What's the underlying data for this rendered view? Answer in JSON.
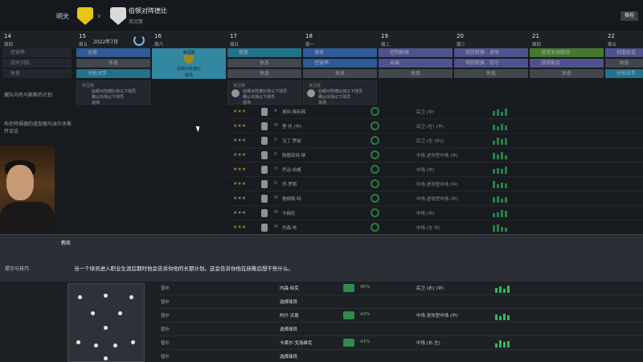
{
  "header": {
    "when": "明天",
    "vs": "v",
    "opponent": "伯顿对阵德比",
    "competition": "英冠赛",
    "right_button": "赛程"
  },
  "calendar": {
    "month": "2022年7月",
    "days": [
      {
        "n": "14",
        "w": "周四"
      },
      {
        "n": "15",
        "w": "周五"
      },
      {
        "n": "16",
        "w": "周六"
      },
      {
        "n": "17",
        "w": "周日"
      },
      {
        "n": "18",
        "w": "周一"
      },
      {
        "n": "19",
        "w": "周二"
      },
      {
        "n": "20",
        "w": "周三"
      },
      {
        "n": "21",
        "w": "周四"
      },
      {
        "n": "22",
        "w": "周五"
      }
    ],
    "left_items": [
      "控球率",
      "战术训练",
      "休息"
    ],
    "col15": [
      "全能",
      "休息",
      "分析对手"
    ],
    "col17": [
      "恢复",
      "休息",
      "休息"
    ],
    "col18": [
      "身体",
      "控球率",
      "休息"
    ],
    "col19": [
      "控制射球",
      "出球",
      "休息"
    ],
    "col20": [
      "攻防转换 - 进攻",
      "攻防转换 - 防守",
      "休息"
    ],
    "col21": [
      "进攻无球跑动",
      "进攻配合",
      "休息"
    ],
    "col22": [
      "创造机会",
      "休息",
      "分析对手"
    ],
    "matchday": {
      "top": "英冠赛",
      "opponent": "伯顿对阵德比",
      "home": "客场"
    }
  },
  "cards": [
    {
      "hd": "英冠赛",
      "l1": "伯顿对阵德比将以下球员",
      "l2": "确认出场以下球员",
      "l3": "首场"
    },
    {
      "hd": "英冠赛",
      "l1": "伯顿对阵德比将以下球员",
      "l2": "确认出场以下球员",
      "l3": "首场"
    },
    {
      "hd": "英冠赛",
      "l1": "伯顿对阵德比将以下球员",
      "l2": "确认出场以下球员",
      "l3": "首场"
    }
  ],
  "sidenotes": [
    "撤队内托马斯斯的计划",
    "布伦特福德的道加德与派尔多斯开议论"
  ],
  "players": [
    {
      "pos": "A",
      "name": "奥利·奥利弗",
      "role": "后卫 (中)"
    },
    {
      "pos": "M",
      "name": "里·托 (中)",
      "role": "后卫 (左) (中)"
    },
    {
      "pos": "D",
      "name": "马丁·罗兹",
      "role": "后卫 (左 (中))"
    },
    {
      "pos": "D",
      "name": "斯图亚特·穆",
      "role": "中场 进攻型中场 (中)"
    },
    {
      "pos": "D",
      "name": "乔治·伯格",
      "role": "中场 (中)"
    },
    {
      "pos": "D",
      "name": "乔·罗斯",
      "role": "中场 进攻型中场 (中)"
    },
    {
      "pos": "M",
      "name": "詹姆斯·特",
      "role": "中场 进攻型中场 (中)"
    },
    {
      "pos": "M",
      "name": "卡梅伦",
      "role": "中场 (中)"
    },
    {
      "pos": "M",
      "name": "杰森·肖",
      "role": "中场 (左 中)"
    }
  ],
  "tip": {
    "title": "教练",
    "category": "提示与技巧",
    "message": "当一个球员进入职业生涯后期时他会告诉你他的长期计划。这会告诉你他在挂靴后想干些什么。"
  },
  "bench": [
    {
      "num": "替补",
      "name": "内森·伯克",
      "role": "后卫 (右) (中)",
      "pct": "45%"
    },
    {
      "num": "替补",
      "name": "选择球员",
      "role": "",
      "pct": ""
    },
    {
      "num": "替补",
      "name": "约什·沃恩",
      "role": "中场 进攻型中场 (中)",
      "pct": "43%"
    },
    {
      "num": "替补",
      "name": "选择球员",
      "role": "",
      "pct": ""
    },
    {
      "num": "替补",
      "name": "卡莱尔·戈洛维克",
      "role": "中场 (右 左)",
      "pct": "41%"
    },
    {
      "num": "替补",
      "name": "选择球员",
      "role": "",
      "pct": ""
    }
  ],
  "colors": {
    "accent": "#43c3ea",
    "blue": "#3e7fd6",
    "violet": "#6e72c9",
    "green": "#5fae3a"
  }
}
